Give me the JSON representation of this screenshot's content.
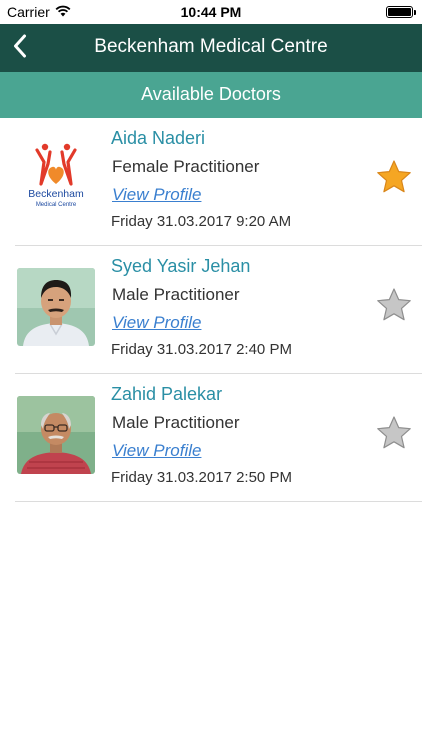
{
  "status_bar": {
    "carrier": "Carrier",
    "time": "10:44 PM",
    "wifi_icon": "wifi-icon",
    "battery_icon": "battery-icon"
  },
  "nav": {
    "back_icon": "chevron-left-icon",
    "title": "Beckenham Medical Centre",
    "background": "#1b4f46"
  },
  "section": {
    "title": "Available Doctors",
    "background": "#4aa592"
  },
  "doctors": [
    {
      "name": "Aida Naderi",
      "role": "Female Practitioner",
      "link": "View Profile",
      "datetime": "Friday 31.03.2017 9:20 AM",
      "favorite": true,
      "avatar": "beckenham-logo",
      "logo_text": "Beckenham Medical Centre"
    },
    {
      "name": "Syed Yasir Jehan",
      "role": "Male Practitioner",
      "link": "View Profile",
      "datetime": "Friday 31.03.2017 2:40 PM",
      "favorite": false,
      "avatar": "doctor-photo"
    },
    {
      "name": "Zahid Palekar",
      "role": "Male Practitioner",
      "link": "View Profile",
      "datetime": "Friday 31.03.2017 2:50 PM",
      "favorite": false,
      "avatar": "doctor-photo"
    }
  ],
  "colors": {
    "name_text": "#2a8fa5",
    "link_text": "#3a7fcf",
    "star_active": "#f5a623",
    "star_inactive": "#b9b9b9"
  }
}
